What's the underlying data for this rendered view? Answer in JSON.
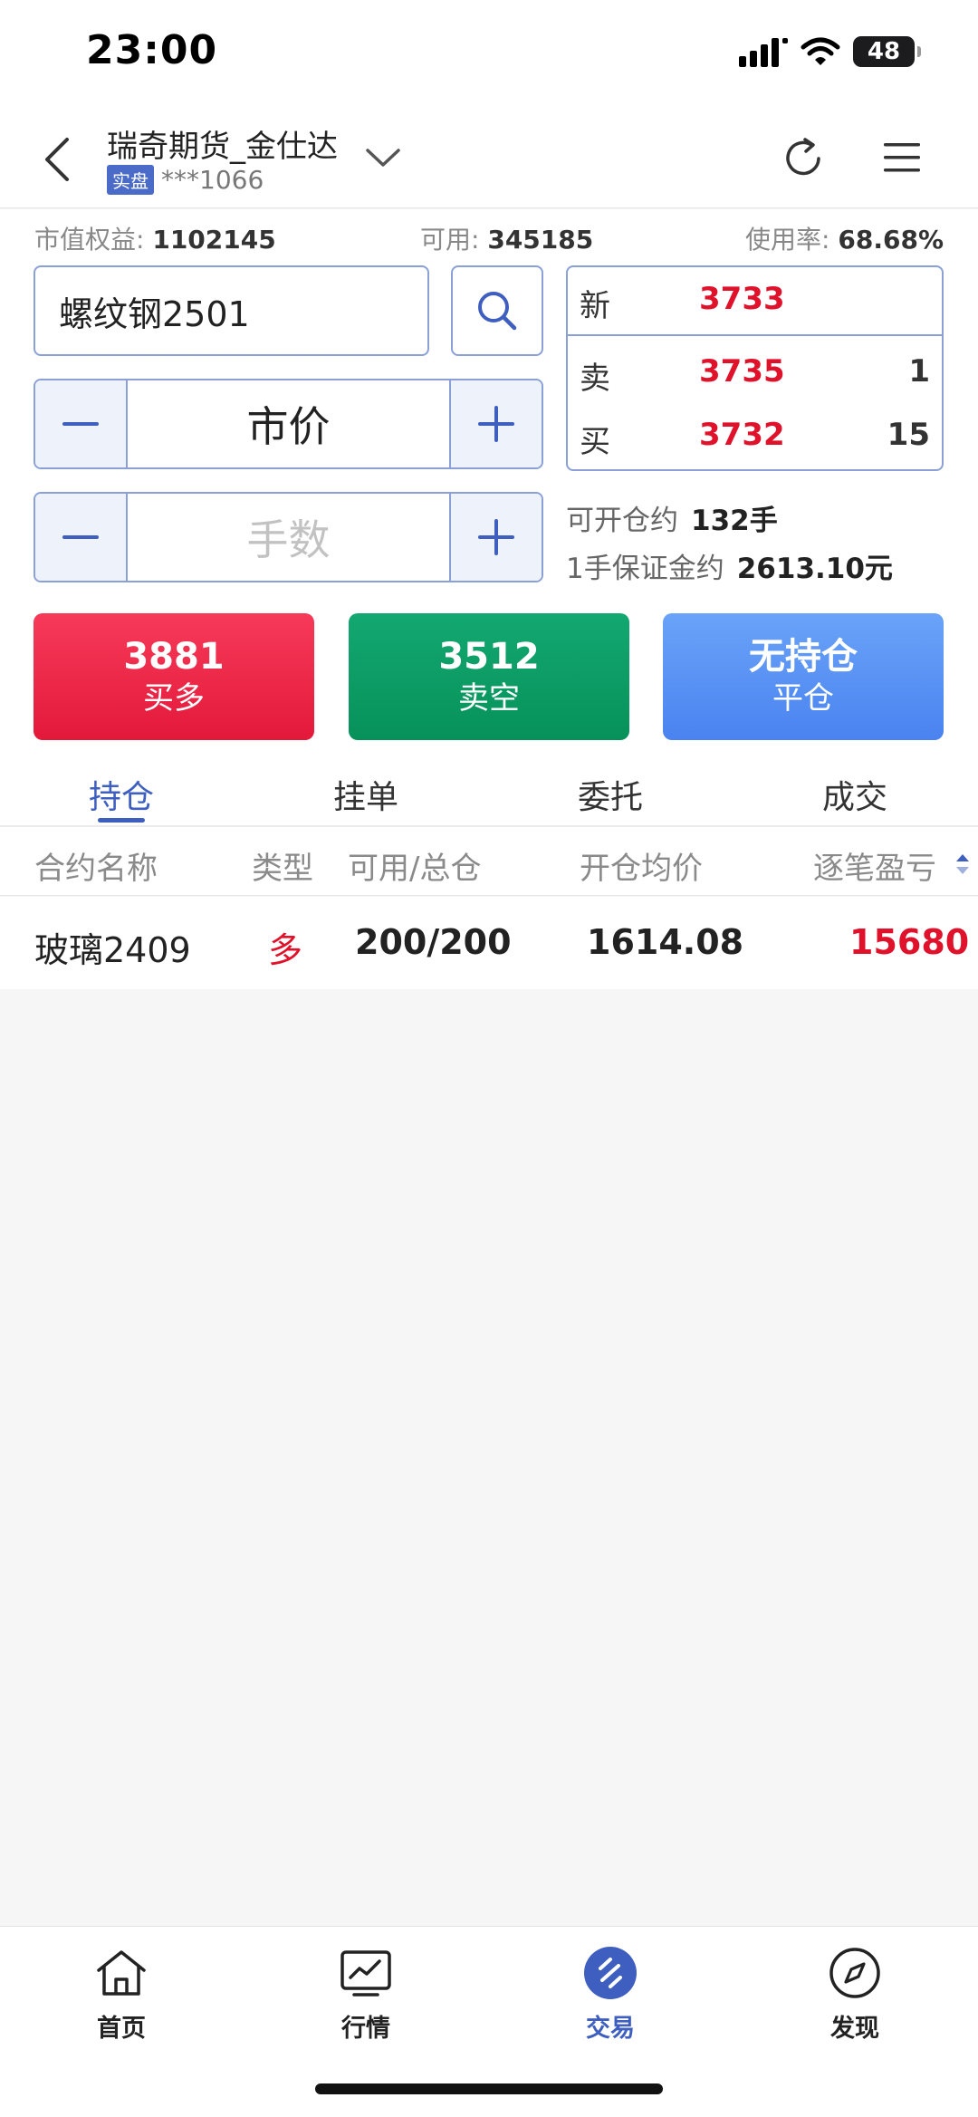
{
  "status_bar": {
    "time": "23:00",
    "battery": "48"
  },
  "header": {
    "account_name": "瑞奇期货_金仕达",
    "badge": "实盘",
    "account_no": "***1066"
  },
  "funds": {
    "equity_label": "市值权益:",
    "equity_value": "1102145",
    "available_label": "可用:",
    "available_value": "345185",
    "usage_label": "使用率:",
    "usage_value": "68.68%"
  },
  "order": {
    "contract": "螺纹钢2501",
    "price_mode": "市价",
    "qty_placeholder": "手数"
  },
  "quote": {
    "last_label": "新",
    "last_price": "3733",
    "ask_label": "卖",
    "ask_price": "3735",
    "ask_qty": "1",
    "bid_label": "买",
    "bid_price": "3732",
    "bid_qty": "15"
  },
  "capacity": {
    "open_label": "可开仓约",
    "open_value": "132手",
    "margin_label": "1手保证金约",
    "margin_value": "2613.10元"
  },
  "actions": {
    "long_price": "3881",
    "long_label": "买多",
    "short_price": "3512",
    "short_label": "卖空",
    "close_top": "无持仓",
    "close_label": "平仓"
  },
  "tabs": [
    "持仓",
    "挂单",
    "委托",
    "成交"
  ],
  "table": {
    "headers": [
      "合约名称",
      "类型",
      "可用/总仓",
      "开仓均价",
      "逐笔盈亏"
    ],
    "rows": [
      {
        "name": "玻璃2409",
        "type": "多",
        "position": "200/200",
        "avg_price": "1614.08",
        "pnl": "15680"
      }
    ]
  },
  "bottom_nav": [
    "首页",
    "行情",
    "交易",
    "发现"
  ],
  "colors": {
    "accent": "#3e5fc0",
    "up": "#e0122b",
    "down": "#07915a",
    "close": "#4a83f0"
  }
}
